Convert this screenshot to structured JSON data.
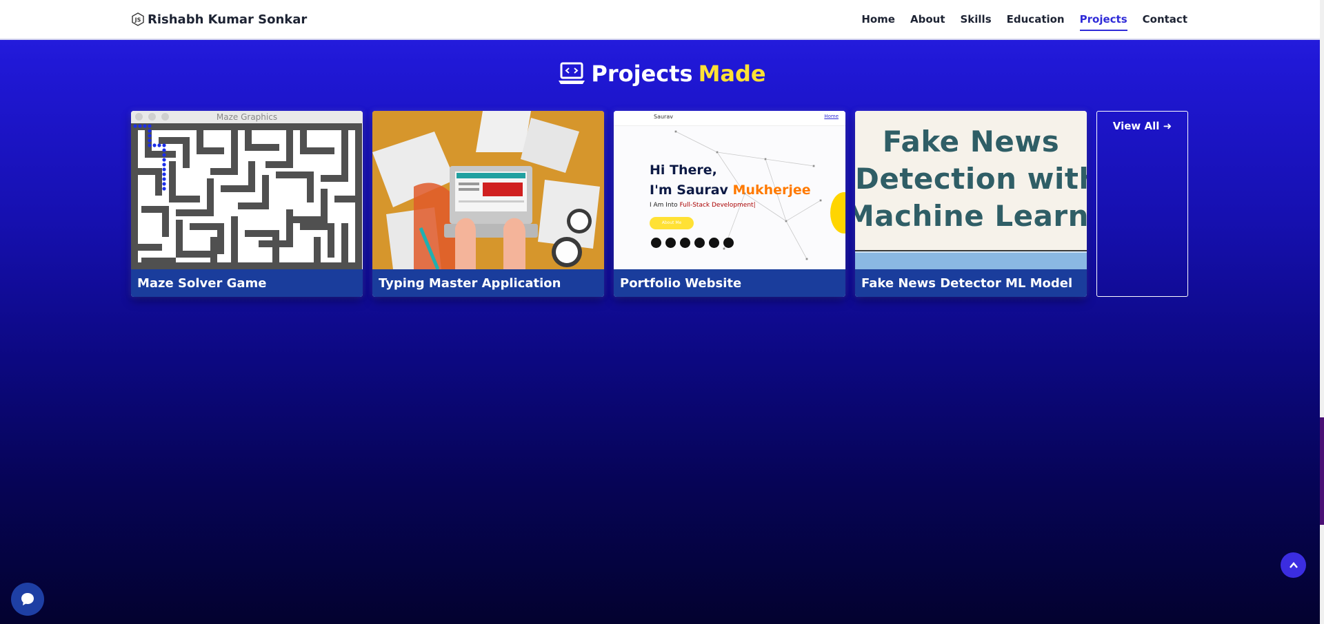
{
  "header": {
    "brand": "Rishabh Kumar Sonkar",
    "nav": [
      {
        "label": "Home"
      },
      {
        "label": "About"
      },
      {
        "label": "Skills"
      },
      {
        "label": "Education"
      },
      {
        "label": "Projects",
        "active": true
      },
      {
        "label": "Contact"
      }
    ]
  },
  "section": {
    "title_main": "Projects",
    "title_accent": "Made",
    "icon": "laptop-code-icon"
  },
  "projects": [
    {
      "title": "Maze Solver Game",
      "thumb_title": "Maze Graphics"
    },
    {
      "title": "Typing Master Application"
    },
    {
      "title": "Portfolio Website",
      "thumb": {
        "logo": "Saurav",
        "nav_home": "Home",
        "greeting_line1": "Hi There,",
        "greeting_line2": "I'm Saurav ",
        "greeting_name": "Mukherjee",
        "subtitle_prefix": "I Am Into ",
        "subtitle_highlight": "Full-Stack Development|",
        "button": "About Me"
      }
    },
    {
      "title": "Fake News Detector ML Model",
      "thumb": {
        "line1": "Fake News",
        "line2": "Detection with",
        "line3": "Machine Learning"
      }
    }
  ],
  "view_all": {
    "label": "View All",
    "icon": "arrow-right-icon"
  },
  "floating": {
    "chat_icon": "chat-bubble-icon",
    "scroll_top_icon": "chevron-up-icon"
  },
  "colors": {
    "accent_yellow": "#ffe135",
    "nav_active": "#2f2bd8",
    "caption_bg": "#1a3d9c"
  }
}
